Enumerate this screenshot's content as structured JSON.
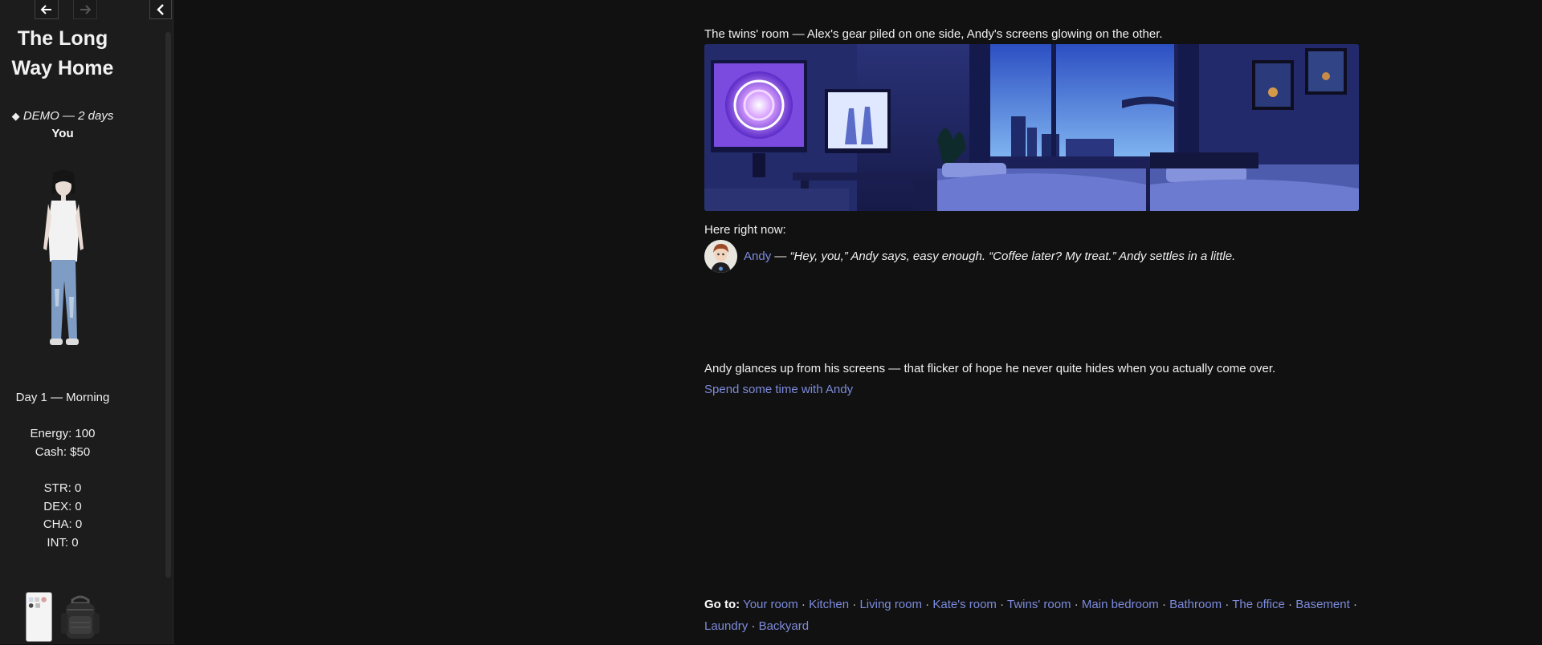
{
  "sidebar": {
    "title": "The Long Way Home",
    "demo_marker": "◆",
    "demo_label": "DEMO — 2 days",
    "player_name": "You",
    "day_time": "Day 1 — Morning",
    "energy": "Energy: 100",
    "cash": "Cash: $50",
    "str": "STR: 0",
    "dex": "DEX: 0",
    "cha": "CHA: 0",
    "int": "INT: 0",
    "icons": {
      "back": "arrow-left-icon",
      "forward": "arrow-right-icon",
      "collapse": "chevron-left-icon"
    }
  },
  "main": {
    "room_caption": "The twins' room — Alex's gear piled on one side, Andy's screens glowing on the other.",
    "here_label": "Here right now:",
    "npc": {
      "name": "Andy",
      "separator": " — ",
      "quote": "“Hey, you,” Andy says, easy enough. “Coffee later? My treat.” Andy settles in a little."
    },
    "narration": "Andy glances up from his screens — that flicker of hope he never quite hides when you actually come over.",
    "action": "Spend some time with Andy",
    "goto": {
      "label": "Go to:",
      "locations": [
        "Your room",
        "Kitchen",
        "Living room",
        "Kate's room",
        "Twins' room",
        "Main bedroom",
        "Bathroom",
        "The office",
        "Basement",
        "Laundry",
        "Backyard"
      ]
    }
  },
  "colors": {
    "background": "#111111",
    "sidebar": "#1c1c1c",
    "link": "#7d8bdc",
    "text": "#f0f0f0"
  }
}
